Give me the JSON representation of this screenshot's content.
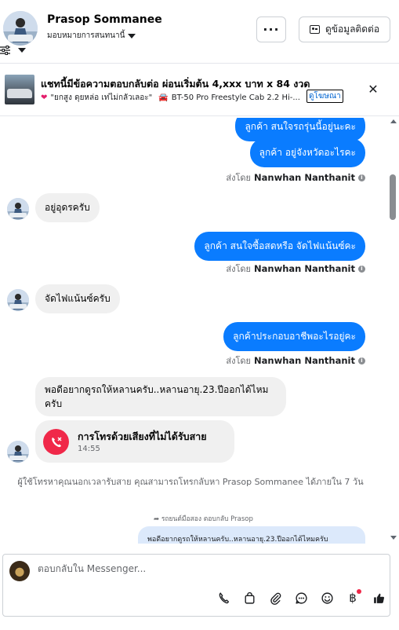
{
  "header": {
    "contact_name": "Prasop Sommanee",
    "assign_label": "มอบหมายการสนทนานี้",
    "more_label": "···",
    "contact_button_label": "ดูข้อมูลติดต่อ"
  },
  "banner": {
    "title": "แชทนี้มีข้อความตอบกลับต่อ ผ่อนเริ่มต้น 4,xxx บาท x 84 งวด",
    "quote": "\"ยกสูง ดุยหล่อ เท่ไม่กลัวเลอะ\"",
    "product": "BT-50 Pro Freestyle Cab 2.2 Hi-...",
    "link_label": "ดูโฆษณา"
  },
  "messages": {
    "out_1": "ลูกค้า สนใจรถรุ่นนี้อยู่นะคะ",
    "out_2": "ลูกค้า อยู่จังหวัดอะไรคะ",
    "sent_by_prefix": "ส่งโดย",
    "sent_by_name": "Nanwhan Nanthanit",
    "in_1": "อยู่อุดรครับ",
    "out_3": "ลูกค้า สนใจซื้อสดหรือ  จัดไฟแน้นซ์คะ",
    "in_2": "จัดไฟแน้นซ์ครับ",
    "out_4": "ลูกค้าประกอบอาชีพอะไรอยู่คะ",
    "in_3": "พอดีอยากดูรถให้หลานครับ..หลานอายุ.23.ปีออกได้ไหมครับ",
    "call_title": "การโทรด้วยเสียงที่ไม่ได้รับสาย",
    "call_time": "14:55",
    "system_note": "ผู้ใช้โทรหาคุณนอกเวลารับสาย คุณสามารถโทรกลับหา Prasop Sommanee ได้ภายใน 7 วัน",
    "reply_label": "รถยนต์มือสอง ตอบกลับ Prasop",
    "reply_quote": "พอดีอยากดูรถให้หลานครับ..หลานอายุ.23.ปีออกได้ไหมครับ"
  },
  "composer": {
    "placeholder": "ตอบกลับใน Messenger...",
    "baht_symbol": "฿"
  },
  "colors": {
    "outgoing_bubble": "#0a7cff",
    "incoming_bubble": "#f0f0f0",
    "missed_call": "#f02849"
  }
}
